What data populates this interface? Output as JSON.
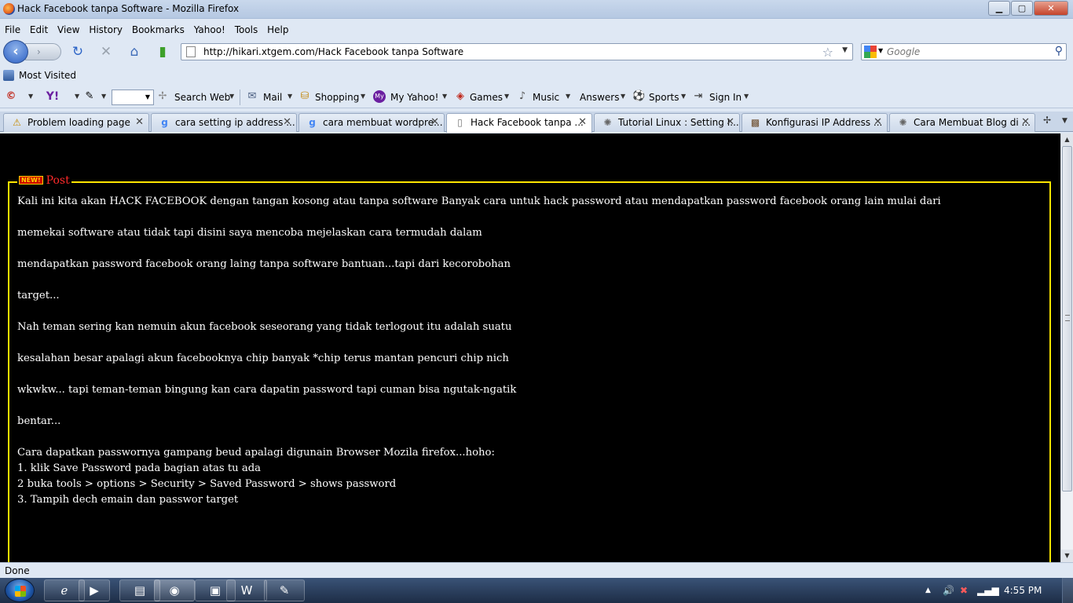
{
  "window": {
    "title": "Hack Facebook tanpa Software - Mozilla Firefox",
    "min_label": "▁",
    "max_label": "▢",
    "close_label": "✕"
  },
  "menu": [
    "File",
    "Edit",
    "View",
    "History",
    "Bookmarks",
    "Yahoo!",
    "Tools",
    "Help"
  ],
  "nav": {
    "url": "http://hikari.xtgem.com/Hack Facebook tanpa Software",
    "search_placeholder": "Google"
  },
  "bookmarks": {
    "most_visited": "Most Visited"
  },
  "yahoo_toolbar": {
    "search_web": "Search Web",
    "mail": "Mail",
    "shopping": "Shopping",
    "my_yahoo": "My Yahoo!",
    "games": "Games",
    "music": "Music",
    "answers": "Answers",
    "sports": "Sports",
    "sign_in": "Sign In"
  },
  "tabs": [
    {
      "label": "Problem loading page",
      "icon": "warning-icon",
      "active": false
    },
    {
      "label": "cara setting ip address ...",
      "icon": "google-icon",
      "active": false
    },
    {
      "label": "cara membuat wordpre...",
      "icon": "google-icon",
      "active": false
    },
    {
      "label": "Hack Facebook tanpa ...",
      "icon": "page-icon",
      "active": true
    },
    {
      "label": "Tutorial Linux : Setting I...",
      "icon": "loading-icon",
      "active": false
    },
    {
      "label": "Konfigurasi IP Address ...",
      "icon": "site-icon",
      "active": false
    },
    {
      "label": "Cara Membuat Blog di ...",
      "icon": "loading-icon",
      "active": false
    }
  ],
  "post": {
    "badge": "NEW!",
    "heading": "Post",
    "lines": [
      "Kali ini kita akan HACK FACEBOOK dengan tangan kosong atau tanpa software Banyak cara untuk hack password atau mendapatkan password facebook orang lain mulai dari",
      "memekai software atau tidak tapi disini saya mencoba mejelaskan cara termudah dalam",
      "mendapatkan password facebook orang laing tanpa software bantuan...tapi dari kecorobohan",
      "target...",
      "Nah teman sering kan nemuin akun facebook seseorang yang tidak terlogout itu adalah suatu",
      "kesalahan besar apalagi akun facebooknya chip banyak *chip terus mantan pencuri chip nich",
      "wkwkw... tapi teman-teman bingung kan cara dapatin password tapi cuman bisa ngutak-ngatik",
      "bentar...",
      "Cara dapatkan passwornya gampang beud apalagi digunain Browser Mozila firefox...hoho:",
      "1. klik Save Password pada bagian atas tu ada",
      "2 buka tools > options > Security > Saved Password > shows password",
      "3. Tampih dech emain dan passwor target"
    ]
  },
  "status": {
    "text": "Done"
  },
  "taskbar": {
    "clock": "4:55 PM"
  },
  "colors": {
    "frame": "#ffe600",
    "heading": "#ff2a2a",
    "page_bg": "#000000",
    "text": "#ffffff"
  }
}
